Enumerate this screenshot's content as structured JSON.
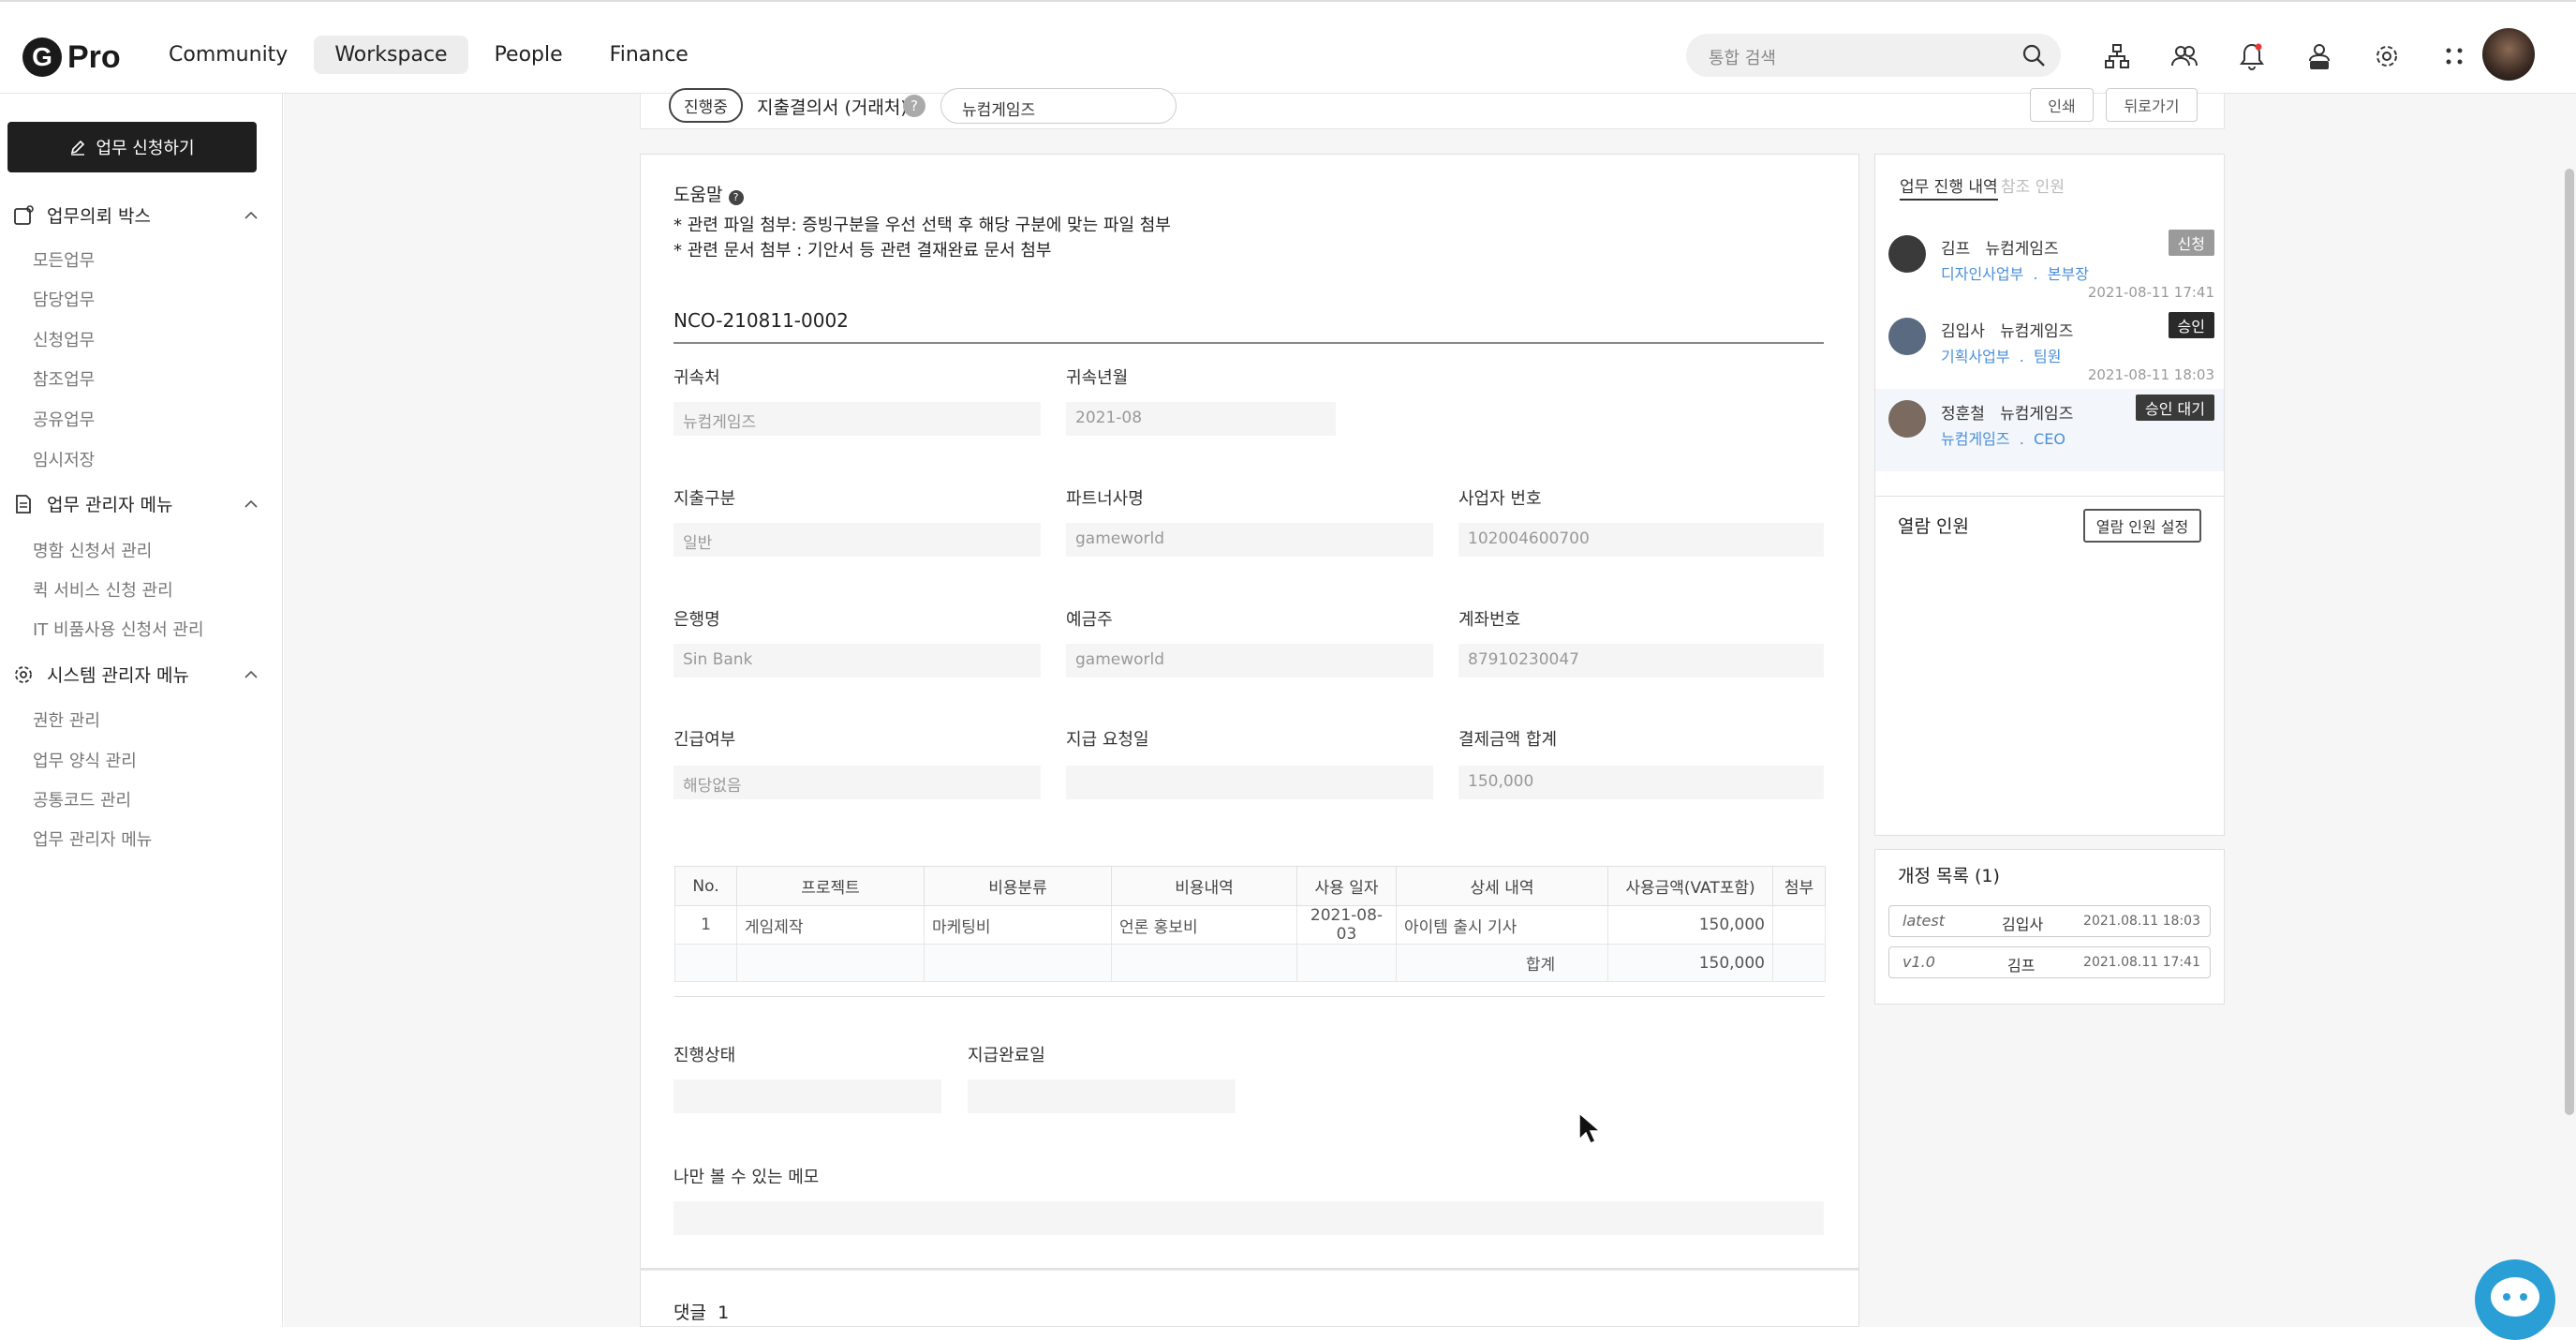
{
  "header": {
    "logo_letter": "G",
    "logo_text": "Pro",
    "nav": [
      "Community",
      "Workspace",
      "People",
      "Finance"
    ],
    "search_placeholder": "통합 검색"
  },
  "sidebar": {
    "request_button": "업무 신청하기",
    "sections": [
      {
        "title": "업무의뢰 박스",
        "items": [
          "모든업무",
          "담당업무",
          "신청업무",
          "참조업무",
          "공유업무",
          "임시저장"
        ]
      },
      {
        "title": "업무 관리자 메뉴",
        "items": [
          "명함 신청서 관리",
          "퀵 서비스 신청 관리",
          "IT 비품사용 신청서 관리"
        ]
      },
      {
        "title": "시스템 관리자 메뉴",
        "items": [
          "권한 관리",
          "업무 양식 관리",
          "공통코드 관리",
          "업무 관리자 메뉴"
        ]
      }
    ]
  },
  "doc": {
    "status": "진행중",
    "title": "지출결의서 (거래처)",
    "company": "뉴컴게임즈",
    "print_label": "인쇄",
    "back_label": "뒤로가기",
    "help_title": "도움말",
    "help_lines": [
      "* 관련 파일 첨부: 증빙구분을 우선 선택 후 해당 구분에 맞는 파일 첨부",
      "* 관련 문서 첨부 : 기안서 등 관련 결재완료 문서 첨부"
    ],
    "doc_no": "NCO-210811-0002",
    "fields": {
      "affiliation": {
        "label": "귀속처",
        "value": "뉴컴게임즈"
      },
      "year_month": {
        "label": "귀속년월",
        "value": "2021-08"
      },
      "expense_type": {
        "label": "지출구분",
        "value": "일반"
      },
      "partner": {
        "label": "파트너사명",
        "value": "gameworld"
      },
      "biz_no": {
        "label": "사업자 번호",
        "value": "102004600700"
      },
      "bank": {
        "label": "은행명",
        "value": "Sin Bank"
      },
      "holder": {
        "label": "예금주",
        "value": "gameworld"
      },
      "account": {
        "label": "계좌번호",
        "value": "87910230047"
      },
      "urgent": {
        "label": "긴급여부",
        "value": "해당없음"
      },
      "pay_date": {
        "label": "지급 요청일",
        "value": ""
      },
      "total": {
        "label": "결제금액 합계",
        "value": "150,000"
      },
      "progress": {
        "label": "진행상태",
        "value": ""
      },
      "done_date": {
        "label": "지급완료일",
        "value": ""
      },
      "memo": {
        "label": "나만 볼 수 있는 메모",
        "value": ""
      }
    },
    "table": {
      "headers": [
        "No.",
        "프로젝트",
        "비용분류",
        "비용내역",
        "사용 일자",
        "상세 내역",
        "사용금액(VAT포함)",
        "첨부"
      ],
      "rows": [
        [
          "1",
          "게임제작",
          "마케팅비",
          "언론 홍보비",
          "2021-08-03",
          "아이템 출시 기사",
          "150,000",
          ""
        ]
      ],
      "sum_label": "합계",
      "sum_value": "150,000"
    },
    "comments_label": "댓글",
    "comments_count": "1"
  },
  "right": {
    "tab_active": "업무 진행 내역",
    "tab_inactive": "참조 인원",
    "history": [
      {
        "name": "김프",
        "company": "뉴컴게임즈",
        "dept": "디자인사업부",
        "role": "본부장",
        "badge": "신청",
        "badge_color": "#9a9a9a",
        "time": "2021-08-11 17:41",
        "av": "#3a3a3a"
      },
      {
        "name": "김입사",
        "company": "뉴컴게임즈",
        "dept": "기획사업부",
        "role": "팀원",
        "badge": "승인",
        "badge_color": "#2a2a2a",
        "time": "2021-08-11 18:03",
        "av": "#5a6a80"
      },
      {
        "name": "정훈철",
        "company": "뉴컴게임즈",
        "dept": "뉴컴게임즈",
        "role": "CEO",
        "badge": "승인 대기",
        "badge_color": "#3a3a3a",
        "time": "",
        "av": "#7a6a60"
      }
    ],
    "viewers_label": "열람 인원",
    "viewers_button": "열람 인원 설정",
    "revision_title": "개정 목록 (1)",
    "revisions": [
      {
        "ver": "latest",
        "name": "김입사",
        "time": "2021.08.11 18:03"
      },
      {
        "ver": "v1.0",
        "name": "김프",
        "time": "2021.08.11 17:41"
      }
    ]
  }
}
